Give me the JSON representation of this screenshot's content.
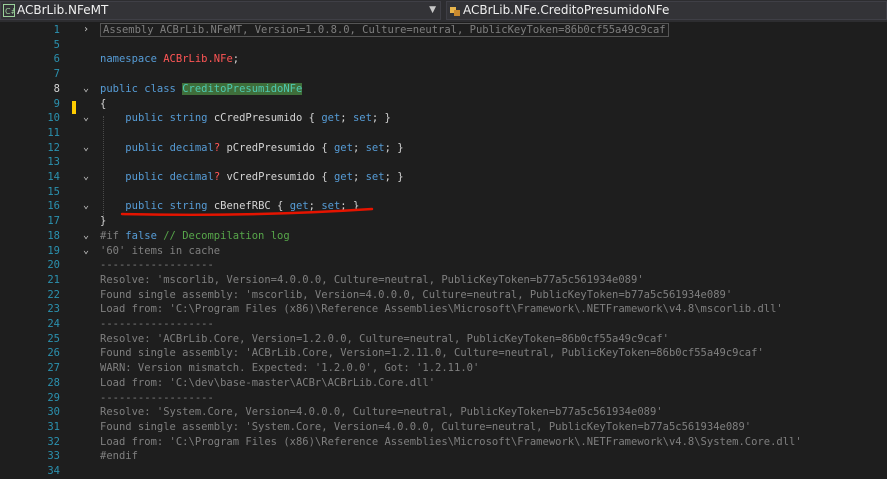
{
  "left_combo": {
    "text": "ACBrLib.NFeMT",
    "icon": "csharp-project-icon"
  },
  "right_combo": {
    "text": "ACBrLib.NFe.CreditoPresumidoNFe",
    "icon": "class-icon"
  },
  "lines": [
    {
      "num": "1",
      "fold": "›",
      "type": "assembly",
      "text": "Assembly ACBrLib.NFeMT, Version=1.0.8.0, Culture=neutral, PublicKeyToken=86b0cf55a49c9caf"
    },
    {
      "num": "5",
      "fold": "",
      "type": "blank"
    },
    {
      "num": "6",
      "fold": "",
      "type": "namespace",
      "kw": "namespace",
      "name": "ACBrLib.NFe",
      "end": ";"
    },
    {
      "num": "7",
      "fold": "",
      "type": "blank"
    },
    {
      "num": "8",
      "fold": "⌄",
      "type": "class",
      "kw1": "public",
      "kw2": "class",
      "name": "CreditoPresumidoNFe"
    },
    {
      "num": "9",
      "fold": "",
      "type": "plain",
      "text": "{"
    },
    {
      "num": "10",
      "fold": "⌄",
      "type": "prop",
      "kw1": "public",
      "type_kw": "string",
      "nullable": "",
      "name": "cCredPresumido",
      "get": "get",
      "set": "set"
    },
    {
      "num": "11",
      "fold": "",
      "type": "blank"
    },
    {
      "num": "12",
      "fold": "⌄",
      "type": "prop",
      "kw1": "public",
      "type_kw": "decimal",
      "nullable": "?",
      "name": "pCredPresumido",
      "get": "get",
      "set": "set"
    },
    {
      "num": "13",
      "fold": "",
      "type": "blank"
    },
    {
      "num": "14",
      "fold": "⌄",
      "type": "prop",
      "kw1": "public",
      "type_kw": "decimal",
      "nullable": "?",
      "name": "vCredPresumido",
      "get": "get",
      "set": "set"
    },
    {
      "num": "15",
      "fold": "",
      "type": "blank"
    },
    {
      "num": "16",
      "fold": "⌄",
      "type": "prop",
      "kw1": "public",
      "type_kw": "string",
      "nullable": "",
      "name": "cBenefRBC",
      "get": "get",
      "set": "set"
    },
    {
      "num": "17",
      "fold": "",
      "type": "plain",
      "text": "}"
    },
    {
      "num": "18",
      "fold": "⌄",
      "type": "directive",
      "kw": "#if",
      "kw2": "false",
      "comment": "// Decompilation log"
    },
    {
      "num": "19",
      "fold": "⌄",
      "type": "gray",
      "text": "'60' items in cache"
    },
    {
      "num": "20",
      "fold": "",
      "type": "gray",
      "text": "------------------"
    },
    {
      "num": "21",
      "fold": "",
      "type": "gray",
      "text": "Resolve: 'mscorlib, Version=4.0.0.0, Culture=neutral, PublicKeyToken=b77a5c561934e089'"
    },
    {
      "num": "22",
      "fold": "",
      "type": "gray",
      "text": "Found single assembly: 'mscorlib, Version=4.0.0.0, Culture=neutral, PublicKeyToken=b77a5c561934e089'"
    },
    {
      "num": "23",
      "fold": "",
      "type": "gray",
      "text": "Load from: 'C:\\Program Files (x86)\\Reference Assemblies\\Microsoft\\Framework\\.NETFramework\\v4.8\\mscorlib.dll'"
    },
    {
      "num": "24",
      "fold": "",
      "type": "gray",
      "text": "------------------"
    },
    {
      "num": "25",
      "fold": "",
      "type": "gray",
      "text": "Resolve: 'ACBrLib.Core, Version=1.2.0.0, Culture=neutral, PublicKeyToken=86b0cf55a49c9caf'"
    },
    {
      "num": "26",
      "fold": "",
      "type": "gray",
      "text": "Found single assembly: 'ACBrLib.Core, Version=1.2.11.0, Culture=neutral, PublicKeyToken=86b0cf55a49c9caf'"
    },
    {
      "num": "27",
      "fold": "",
      "type": "gray",
      "text": "WARN: Version mismatch. Expected: '1.2.0.0', Got: '1.2.11.0'"
    },
    {
      "num": "28",
      "fold": "",
      "type": "gray",
      "text": "Load from: 'C:\\dev\\base-master\\ACBr\\ACBrLib.Core.dll'"
    },
    {
      "num": "29",
      "fold": "",
      "type": "gray",
      "text": "------------------"
    },
    {
      "num": "30",
      "fold": "",
      "type": "gray",
      "text": "Resolve: 'System.Core, Version=4.0.0.0, Culture=neutral, PublicKeyToken=b77a5c561934e089'"
    },
    {
      "num": "31",
      "fold": "",
      "type": "gray",
      "text": "Found single assembly: 'System.Core, Version=4.0.0.0, Culture=neutral, PublicKeyToken=b77a5c561934e089'"
    },
    {
      "num": "32",
      "fold": "",
      "type": "gray",
      "text": "Load from: 'C:\\Program Files (x86)\\Reference Assemblies\\Microsoft\\Framework\\.NETFramework\\v4.8\\System.Core.dll'"
    },
    {
      "num": "33",
      "fold": "",
      "type": "gray",
      "text": "#endif"
    },
    {
      "num": "34",
      "fold": "",
      "type": "blank"
    }
  ],
  "colors": {
    "keyword": "#569cd6",
    "class": "#4ec9b0",
    "comment": "#57a64a",
    "underline": "#e51400"
  }
}
